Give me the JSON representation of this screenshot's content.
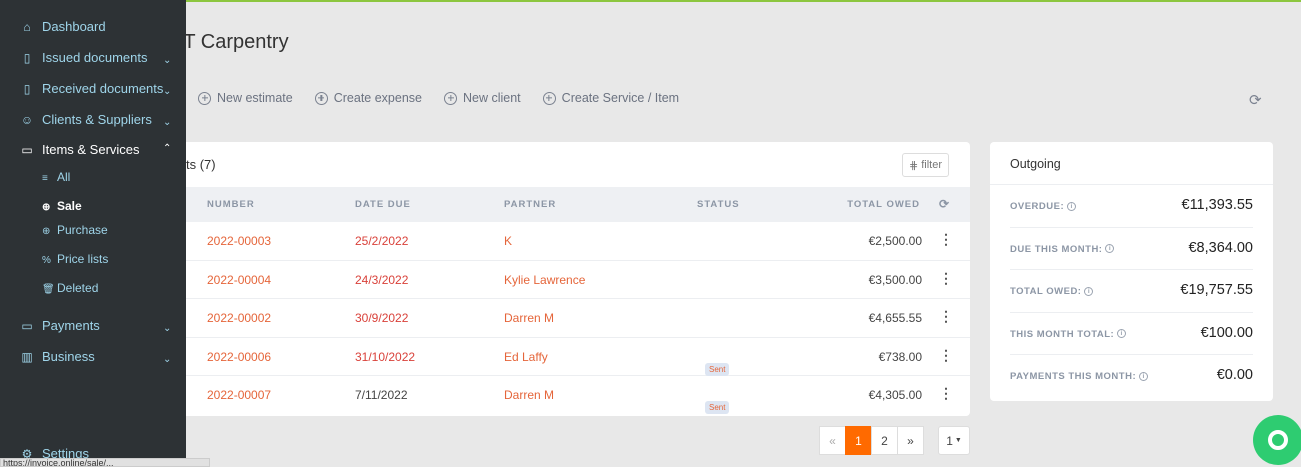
{
  "page": {
    "title": "VT Carpentry"
  },
  "actions": [
    {
      "label": "New estimate"
    },
    {
      "label": "Create expense"
    },
    {
      "label": "New client"
    },
    {
      "label": "Create Service / Item"
    }
  ],
  "table": {
    "title": "ts (7)",
    "filter_label": "filter",
    "columns": {
      "number": "NUMBER",
      "date_due": "DATE DUE",
      "partner": "PARTNER",
      "status": "STATUS",
      "total_owed": "TOTAL OWED"
    },
    "rows": [
      {
        "number": "2022-00003",
        "date_due": "25/2/2022",
        "partner": "K",
        "status": "",
        "total": "€2,500.00"
      },
      {
        "number": "2022-00004",
        "date_due": "24/3/2022",
        "partner": "Kylie Lawrence",
        "status": "",
        "total": "€3,500.00"
      },
      {
        "number": "2022-00002",
        "date_due": "30/9/2022",
        "partner": "Darren M",
        "status": "",
        "total": "€4,655.55"
      },
      {
        "number": "2022-00006",
        "date_due": "31/10/2022",
        "partner": "Ed Laffy",
        "status": "Sent",
        "total": "€738.00"
      },
      {
        "number": "2022-00007",
        "date_due": "7/11/2022",
        "partner": "Darren M",
        "status": "Sent",
        "total": "€4,305.00"
      }
    ]
  },
  "pagination": {
    "prev": "«",
    "pages": [
      "1",
      "2"
    ],
    "next": "»",
    "current": "1",
    "per_page": "1"
  },
  "outgoing": {
    "title": "Outgoing",
    "rows": [
      {
        "label": "OVERDUE:",
        "value": "€11,393.55"
      },
      {
        "label": "DUE THIS MONTH:",
        "value": "€8,364.00"
      },
      {
        "label": "TOTAL OWED:",
        "value": "€19,757.55"
      },
      {
        "label": "THIS MONTH TOTAL:",
        "value": "€100.00"
      },
      {
        "label": "PAYMENTS THIS MONTH:",
        "value": "€0.00"
      }
    ]
  },
  "sidebar": {
    "items": [
      {
        "label": "Dashboard"
      },
      {
        "label": "Issued documents"
      },
      {
        "label": "Received documents"
      },
      {
        "label": "Clients & Suppliers"
      },
      {
        "label": "Items & Services"
      },
      {
        "label": "Payments"
      },
      {
        "label": "Business"
      },
      {
        "label": "Settings"
      }
    ],
    "sub_items": [
      {
        "label": "All"
      },
      {
        "label": "Sale"
      },
      {
        "label": "Purchase"
      },
      {
        "label": "Price lists"
      },
      {
        "label": "Deleted"
      }
    ]
  },
  "status_bar": {
    "url": "https://invoice.online/sale/..."
  },
  "colors": {
    "accent": "#ff6a00",
    "sidebar_bg": "#2d3235",
    "link": "#e5653a",
    "help_button": "#2ecc71"
  }
}
